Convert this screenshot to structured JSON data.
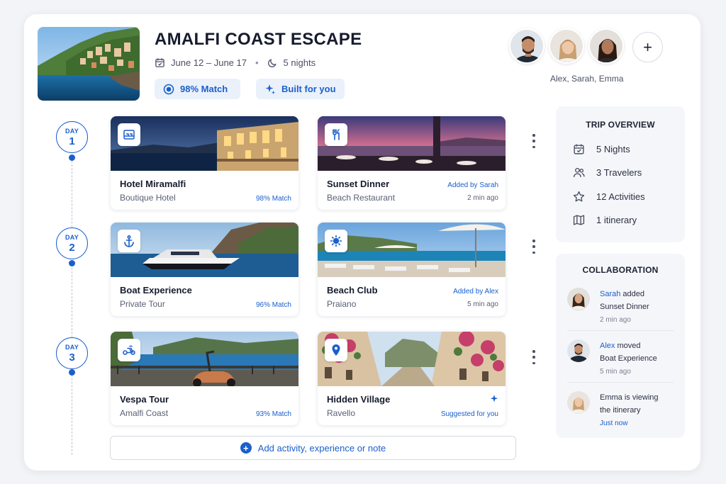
{
  "trip": {
    "title": "AMALFI COAST ESCAPE",
    "dates": "June 12 – June 17",
    "nights": "5 nights",
    "match_chip": "98% Match",
    "built_chip": "Built for you"
  },
  "collaborators": {
    "names": "Alex, Sarah, Emma",
    "add_label": "+"
  },
  "days": [
    {
      "label": "DAY",
      "number": "1"
    },
    {
      "label": "DAY",
      "number": "2"
    },
    {
      "label": "DAY",
      "number": "3"
    }
  ],
  "activities": [
    {
      "title": "Hotel Miramalfi",
      "subtitle": "Boutique Hotel",
      "right": "98% Match",
      "icon": "hotel-icon"
    },
    {
      "title": "Sunset Dinner",
      "subtitle": "Beach Restaurant",
      "right_top": "Added by Sarah",
      "right_bottom": "2 min ago",
      "icon": "restaurant-icon"
    },
    {
      "title": "Boat Experience",
      "subtitle": "Private Tour",
      "right": "96% Match",
      "icon": "anchor-icon"
    },
    {
      "title": "Beach Club",
      "subtitle": "Praiano",
      "right_top": "Added by Alex",
      "right_bottom": "5 min ago",
      "icon": "sun-icon"
    },
    {
      "title": "Vespa Tour",
      "subtitle": "Amalfi Coast",
      "right": "93% Match",
      "icon": "scooter-icon"
    },
    {
      "title": "Hidden Village",
      "subtitle": "Ravello",
      "right": "Suggested for you",
      "icon": "location-pin-icon"
    }
  ],
  "add_activity": "Add activity, experience or note",
  "overview": {
    "heading": "TRIP OVERVIEW",
    "items": [
      "5 Nights",
      "3 Travelers",
      "12 Activities",
      "1 itinerary"
    ]
  },
  "collaboration": {
    "heading": "COLLABORATION",
    "feed": [
      {
        "who": "Sarah",
        "action": " added",
        "object": "Sunset Dinner",
        "time": "2 min ago"
      },
      {
        "who": "Alex",
        "action": " moved",
        "object": "Boat Experience",
        "time": "5 min ago"
      },
      {
        "who": "Emma",
        "action": " is viewing",
        "object": "the itinerary",
        "time": "Just now"
      }
    ]
  },
  "colors": {
    "accent": "#1a5fcc",
    "chip_bg": "#eaf1fb",
    "panel_bg": "#f5f6f9"
  }
}
